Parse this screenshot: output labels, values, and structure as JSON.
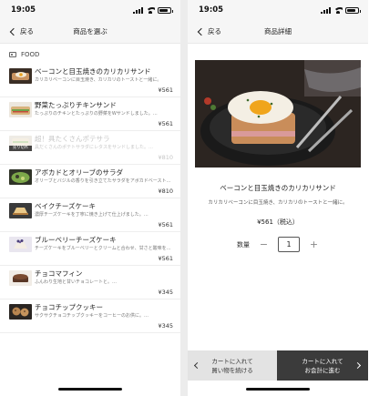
{
  "status_bar": {
    "time": "19:05",
    "location_glyph": "⬈"
  },
  "list_screen": {
    "back_label": "戻る",
    "title": "商品を選ぶ",
    "section": "FOOD",
    "sold_out_label": "売り切れ",
    "items": [
      {
        "name": "ベーコンと目玉焼きのカリカリサンド",
        "desc": "カリカリベーコンに目玉焼き、カリカリのトーストと一緒に。",
        "price": "¥561",
        "sold_out": false
      },
      {
        "name": "野菜たっぷりチキンサンド",
        "desc": "たっぷりのチキンとたっぷりの野菜をWサンドしました。…",
        "price": "¥561",
        "sold_out": false
      },
      {
        "name": "超！具たくさんポテサラ",
        "desc": "具だくさんのポテトサラダにレタスをサンドしました。…",
        "price": "¥810",
        "sold_out": true
      },
      {
        "name": "アボカドとオリーブのサラダ",
        "desc": "オリーブとバジルの香りを引き立てたサラダをアボカドベーストと一緒に。",
        "price": "¥810",
        "sold_out": false
      },
      {
        "name": "ベイクチーズケーキ",
        "desc": "濃厚チーズケーキを丁寧に焼き上げて仕上げました。…",
        "price": "¥561",
        "sold_out": false
      },
      {
        "name": "ブルーベリーチーズケーキ",
        "desc": "チーズケーキをブルーベリーとクリームと合わせ、甘さと酸味を生かしました。",
        "price": "¥561",
        "sold_out": false
      },
      {
        "name": "チョコマフィン",
        "desc": "ふんわり生地と甘いチョコレートと。…",
        "price": "¥345",
        "sold_out": false
      },
      {
        "name": "チョコチップクッキー",
        "desc": "サクサクチョコチップクッキーをコーヒーのお供に。…",
        "price": "¥345",
        "sold_out": false
      }
    ]
  },
  "detail_screen": {
    "back_label": "戻る",
    "title": "商品詳細",
    "product_name": "ベーコンと目玉焼きのカリカリサンド",
    "description": "カリカリベーコンに目玉焼き、カリカリのトーストと一緒に。",
    "price": "¥561（税込）",
    "quantity_label": "数量",
    "quantity": "1",
    "minus": "−",
    "plus": "+",
    "continue_line1": "カートに入れて",
    "continue_line2": "買い物を続ける",
    "checkout_line1": "カートに入れて",
    "checkout_line2": "お会計に進む"
  },
  "colors": {
    "accent_dark": "#3b3b3b",
    "bar_bg": "#f6f6f6",
    "button_light": "#e3e3e3"
  }
}
